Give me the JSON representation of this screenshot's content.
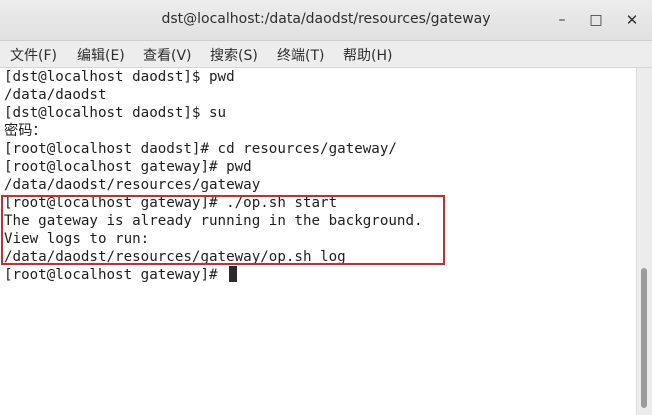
{
  "window": {
    "title": "dst@localhost:/data/daodst/resources/gateway",
    "minimize_glyph": "–",
    "maximize_glyph": "□",
    "close_glyph": "✕"
  },
  "menu": [
    "文件(F)",
    "编辑(E)",
    "查看(V)",
    "搜索(S)",
    "终端(T)",
    "帮助(H)"
  ],
  "terminal": {
    "lines": [
      "[dst@localhost daodst]$ pwd",
      "/data/daodst",
      "[dst@localhost daodst]$ su",
      "密码：",
      "[root@localhost daodst]# cd resources/gateway/",
      "[root@localhost gateway]# pwd",
      "/data/daodst/resources/gateway",
      "[root@localhost gateway]# ./op.sh start",
      "The gateway is already running in the background.",
      "View logs to run:",
      "/data/daodst/resources/gateway/op.sh log",
      "[root@localhost gateway]# "
    ]
  },
  "colors": {
    "highlight_border": "#d7262c",
    "terminal_bg": "#ffffff",
    "text": "#1e1e1e"
  }
}
